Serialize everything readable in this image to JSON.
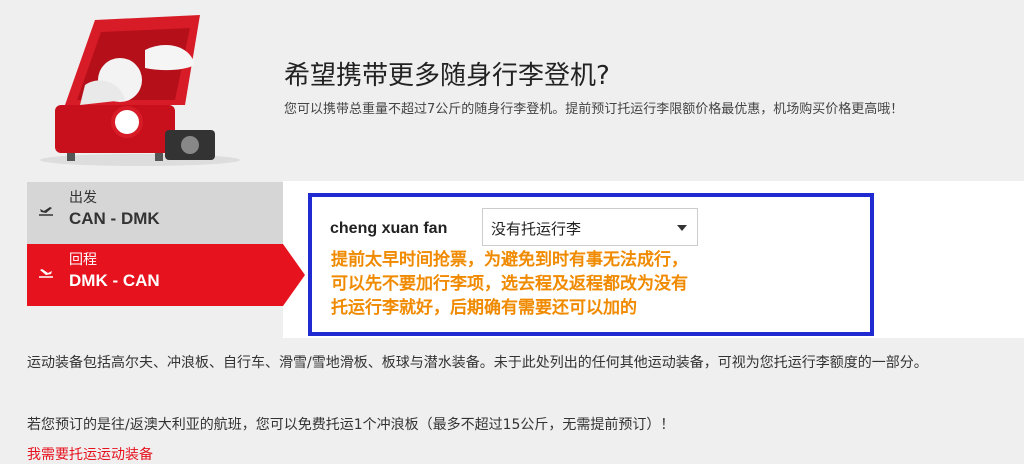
{
  "hero": {
    "title": "希望携带更多随身行李登机?",
    "subtitle": "您可以携带总重量不超过7公斤的随身行李登机。提前预订托运行李限额价格最优惠，机场购买价格更高哦！"
  },
  "flights": [
    {
      "label": "出发",
      "route": "CAN - DMK",
      "icon": "plane-depart-icon"
    },
    {
      "label": "回程",
      "route": "DMK - CAN",
      "icon": "plane-return-icon"
    }
  ],
  "passenger": {
    "name": "cheng xuan fan",
    "baggage_select": "没有托运行李"
  },
  "annotation": {
    "lines": [
      "提前太早时间抢票，为避免到时有事无法成行，",
      "可以先不要加行李项，选去程及返程都改为没有",
      "托运行李就好，后期确有需要还可以加的"
    ]
  },
  "info": {
    "sports": "运动装备包括高尔夫、冲浪板、自行车、滑雪/雪地滑板、板球与潜水装备。未于此处列出的任何其他运动装备，可视为您托运行李额度的一部分。",
    "australia": "若您预订的是往/返澳大利亚的航班，您可以免费托运1个冲浪板（最多不超过15公斤，无需提前预订）！",
    "link": "我需要托运运动装备"
  },
  "colors": {
    "accent": "#e6131f",
    "annotation_border": "#1f2bd1",
    "annotation_text": "#f08a00"
  }
}
